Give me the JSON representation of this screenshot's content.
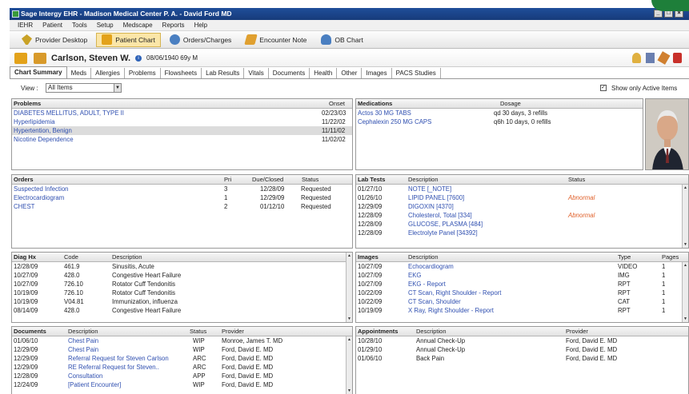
{
  "window": {
    "title": "Sage Intergy EHR - Madison Medical Center P. A. - David Ford MD",
    "min": "_",
    "max": "□",
    "close": "×"
  },
  "menu": [
    "IEHR",
    "Patient",
    "Tools",
    "Setup",
    "Medscape",
    "Reports",
    "Help"
  ],
  "toolbar": [
    {
      "label": "Provider Desktop",
      "icon": "provider-desktop-icon",
      "color": "#c9a227"
    },
    {
      "label": "Patient Chart",
      "icon": "patient-chart-icon",
      "color": "#e3a21a"
    },
    {
      "label": "Orders/Charges",
      "icon": "orders-icon",
      "color": "#4a7fc1"
    },
    {
      "label": "Encounter Note",
      "icon": "encounter-note-icon",
      "color": "#e0a030"
    },
    {
      "label": "OB Chart",
      "icon": "ob-chart-icon",
      "color": "#4a7fc1"
    }
  ],
  "patient": {
    "name": "Carlson, Steven W.",
    "dob": "08/06/1940 69y M"
  },
  "tabs": [
    "Chart Summary",
    "Meds",
    "Allergies",
    "Problems",
    "Flowsheets",
    "Lab Results",
    "Vitals",
    "Documents",
    "Health",
    "Other",
    "Images",
    "PACS Studies"
  ],
  "view": {
    "label": "View :",
    "value": "All Items",
    "active_only": "Show only Active Items"
  },
  "problems": {
    "title": "Problems",
    "col_onset": "Onset",
    "rows": [
      {
        "name": "DIABETES MELLITUS, ADULT, TYPE II",
        "onset": "02/23/03"
      },
      {
        "name": "Hyperlipidemia",
        "onset": "11/22/02"
      },
      {
        "name": "Hypertention, Benign",
        "onset": "11/11/02"
      },
      {
        "name": "Nicotine Dependence",
        "onset": "11/02/02"
      }
    ]
  },
  "medications": {
    "title": "Medications",
    "col_dosage": "Dosage",
    "rows": [
      {
        "name": "Actos 30 MG TABS",
        "dosage": "qd 30 days, 3 refills"
      },
      {
        "name": "Cephalexin 250 MG CAPS",
        "dosage": "q6h 10 days, 0 refills"
      }
    ]
  },
  "orders": {
    "title": "Orders",
    "col_pri": "Pri",
    "col_due": "Due/Closed",
    "col_status": "Status",
    "rows": [
      {
        "name": "Suspected Infection",
        "pri": "3",
        "due": "12/28/09",
        "status": "Requested"
      },
      {
        "name": "Electrocardiogram",
        "pri": "1",
        "due": "12/29/09",
        "status": "Requested"
      },
      {
        "name": "CHEST",
        "pri": "2",
        "due": "01/12/10",
        "status": "Requested"
      }
    ]
  },
  "labs": {
    "title": "Lab Tests",
    "col_desc": "Description",
    "col_status": "Status",
    "rows": [
      {
        "date": "01/27/10",
        "desc": "NOTE [_NOTE]",
        "status": ""
      },
      {
        "date": "01/26/10",
        "desc": "LIPID PANEL [7600]",
        "status": "Abnormal"
      },
      {
        "date": "12/29/09",
        "desc": "DIGOXIN [4370]",
        "status": ""
      },
      {
        "date": "12/28/09",
        "desc": "Cholesterol, Total [334]",
        "status": "Abnormal"
      },
      {
        "date": "12/28/09",
        "desc": "GLUCOSE, PLASMA [484]",
        "status": ""
      },
      {
        "date": "12/28/09",
        "desc": "Electrolyte Panel [34392]",
        "status": ""
      }
    ]
  },
  "diag": {
    "title": "Diag Hx",
    "col_code": "Code",
    "col_desc": "Description",
    "rows": [
      {
        "date": "12/28/09",
        "code": "461.9",
        "desc": "Sinusitis, Acute"
      },
      {
        "date": "10/27/09",
        "code": "428.0",
        "desc": "Congestive Heart Failure"
      },
      {
        "date": "10/27/09",
        "code": "726.10",
        "desc": "Rotator Cuff Tendonitis"
      },
      {
        "date": "10/19/09",
        "code": "726.10",
        "desc": "Rotator Cuff Tendonitis"
      },
      {
        "date": "10/19/09",
        "code": "V04.81",
        "desc": "Immunization, influenza"
      },
      {
        "date": "08/14/09",
        "code": "428.0",
        "desc": "Congestive Heart Failure"
      }
    ]
  },
  "images": {
    "title": "Images",
    "col_desc": "Description",
    "col_type": "Type",
    "col_pages": "Pages",
    "rows": [
      {
        "date": "10/27/09",
        "desc": "Echocardiogram",
        "type": "VIDEO",
        "pages": "1"
      },
      {
        "date": "10/27/09",
        "desc": "EKG",
        "type": "IMG",
        "pages": "1"
      },
      {
        "date": "10/27/09",
        "desc": "EKG - Report",
        "type": "RPT",
        "pages": "1"
      },
      {
        "date": "10/22/09",
        "desc": "CT Scan, Right Shoulder - Report",
        "type": "RPT",
        "pages": "1"
      },
      {
        "date": "10/22/09",
        "desc": "CT Scan, Shoulder",
        "type": "CAT",
        "pages": "1"
      },
      {
        "date": "10/19/09",
        "desc": "X Ray, Right Shoulder - Report",
        "type": "RPT",
        "pages": "1"
      }
    ]
  },
  "documents": {
    "title": "Documents",
    "col_desc": "Description",
    "col_status": "Status",
    "col_provider": "Provider",
    "rows": [
      {
        "date": "01/06/10",
        "desc": "Chest Pain",
        "status": "WIP",
        "provider": "Monroe, James T. MD"
      },
      {
        "date": "12/29/09",
        "desc": "Chest Pain",
        "status": "WIP",
        "provider": "Ford, David E. MD"
      },
      {
        "date": "12/29/09",
        "desc": "Referral Request for Steven Carlson",
        "status": "ARC",
        "provider": "Ford, David E. MD"
      },
      {
        "date": "12/29/09",
        "desc": "RE Referral Request for Steven..",
        "status": "ARC",
        "provider": "Ford, David E. MD"
      },
      {
        "date": "12/28/09",
        "desc": "Consultation",
        "status": "APP",
        "provider": "Ford, David E. MD"
      },
      {
        "date": "12/24/09",
        "desc": "[Patient Encounter]",
        "status": "WIP",
        "provider": "Ford, David E. MD"
      }
    ]
  },
  "appointments": {
    "title": "Appointments",
    "col_desc": "Description",
    "col_provider": "Provider",
    "rows": [
      {
        "date": "10/28/10",
        "desc": "Annual Check-Up",
        "provider": "Ford, David E. MD"
      },
      {
        "date": "01/29/10",
        "desc": "Annual Check-Up",
        "provider": "Ford, David E. MD"
      },
      {
        "date": "01/06/10",
        "desc": "Back Pain",
        "provider": "Ford, David E. MD"
      }
    ]
  },
  "colors": {
    "titlebar": "#1f4e9a",
    "link": "#2f4fb0",
    "abnormal": "#e0602a",
    "active_button": "#fbe6a8"
  }
}
